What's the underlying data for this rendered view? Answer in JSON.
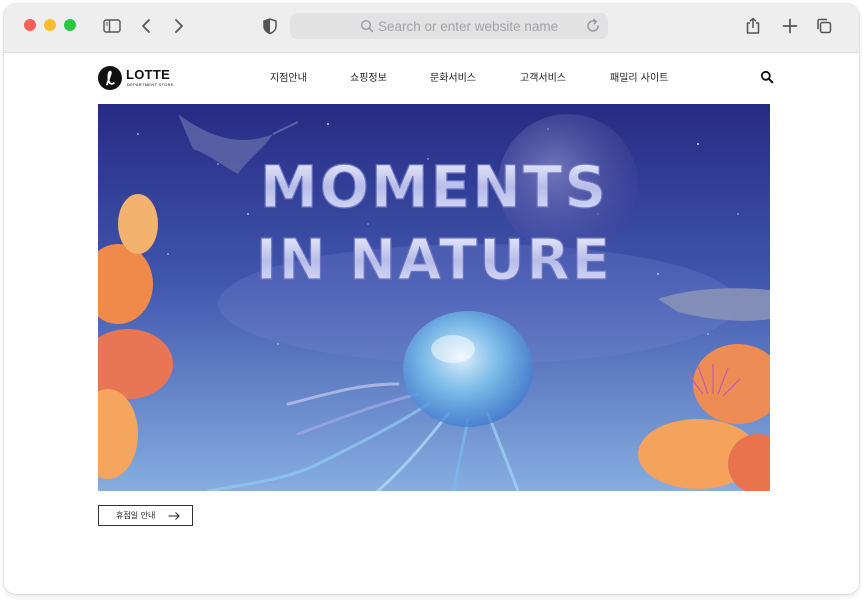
{
  "browser": {
    "address_placeholder": "Search or enter website name"
  },
  "site": {
    "logo": {
      "name": "LOTTE",
      "sub": "DEPARTMENT STORE"
    },
    "nav": [
      {
        "label": "지점안내"
      },
      {
        "label": "쇼핑정보"
      },
      {
        "label": "문화서비스"
      },
      {
        "label": "고객서비스"
      },
      {
        "label": "패밀리 사이트"
      }
    ],
    "hero": {
      "line1": "MOMENTS",
      "line2": "IN NATURE"
    },
    "holiday_button": {
      "label": "휴점일 안내"
    }
  },
  "colors": {
    "accent": "#111111",
    "sky_top": "#2a2f86",
    "sky_bottom": "#7fa8de",
    "coral": "#f08a4b"
  }
}
